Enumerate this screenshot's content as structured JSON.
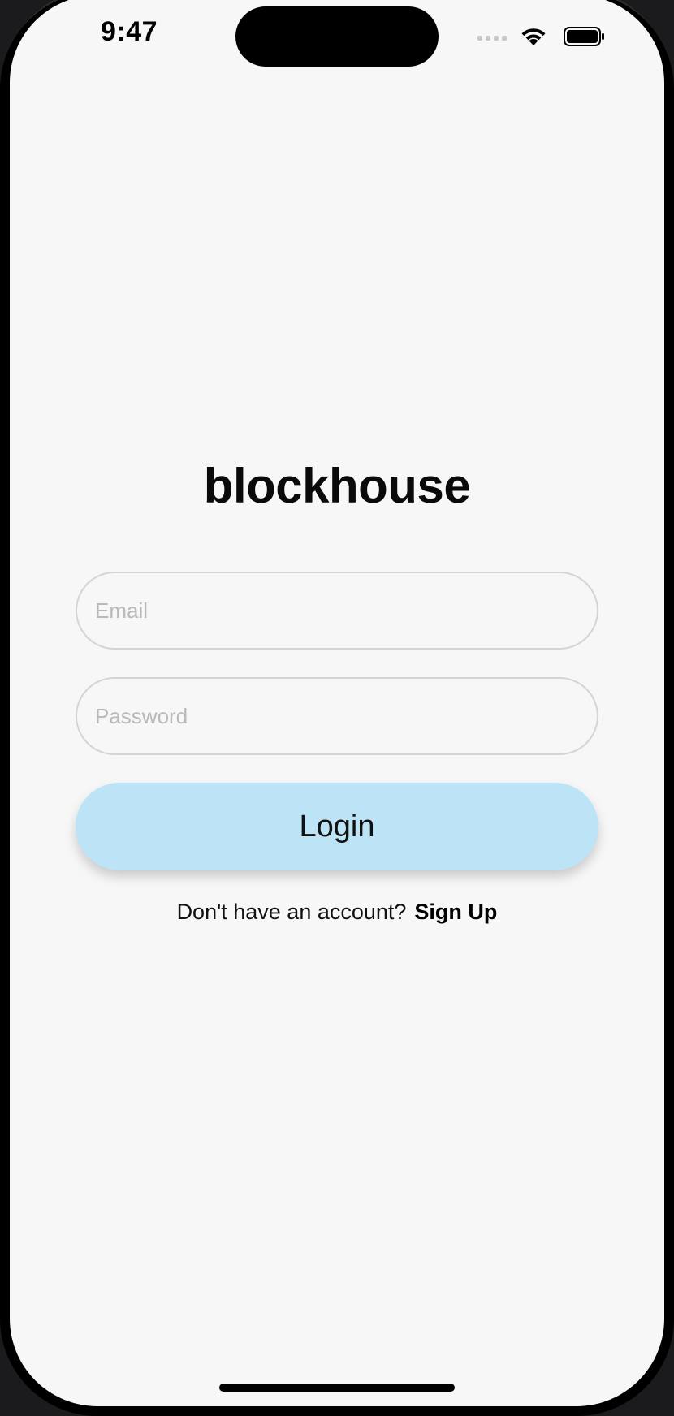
{
  "status_bar": {
    "time": "9:47"
  },
  "app": {
    "title": "blockhouse"
  },
  "form": {
    "email": {
      "placeholder": "Email",
      "value": ""
    },
    "password": {
      "placeholder": "Password",
      "value": ""
    },
    "login_label": "Login"
  },
  "signup": {
    "prompt": "Don't have an account?",
    "link_label": "Sign Up"
  },
  "colors": {
    "background": "#f7f7f7",
    "login_button": "#bde4f6",
    "field_border": "#d4d4d4"
  },
  "icons": [
    "cellular-signal-icon",
    "wifi-icon",
    "battery-icon"
  ]
}
